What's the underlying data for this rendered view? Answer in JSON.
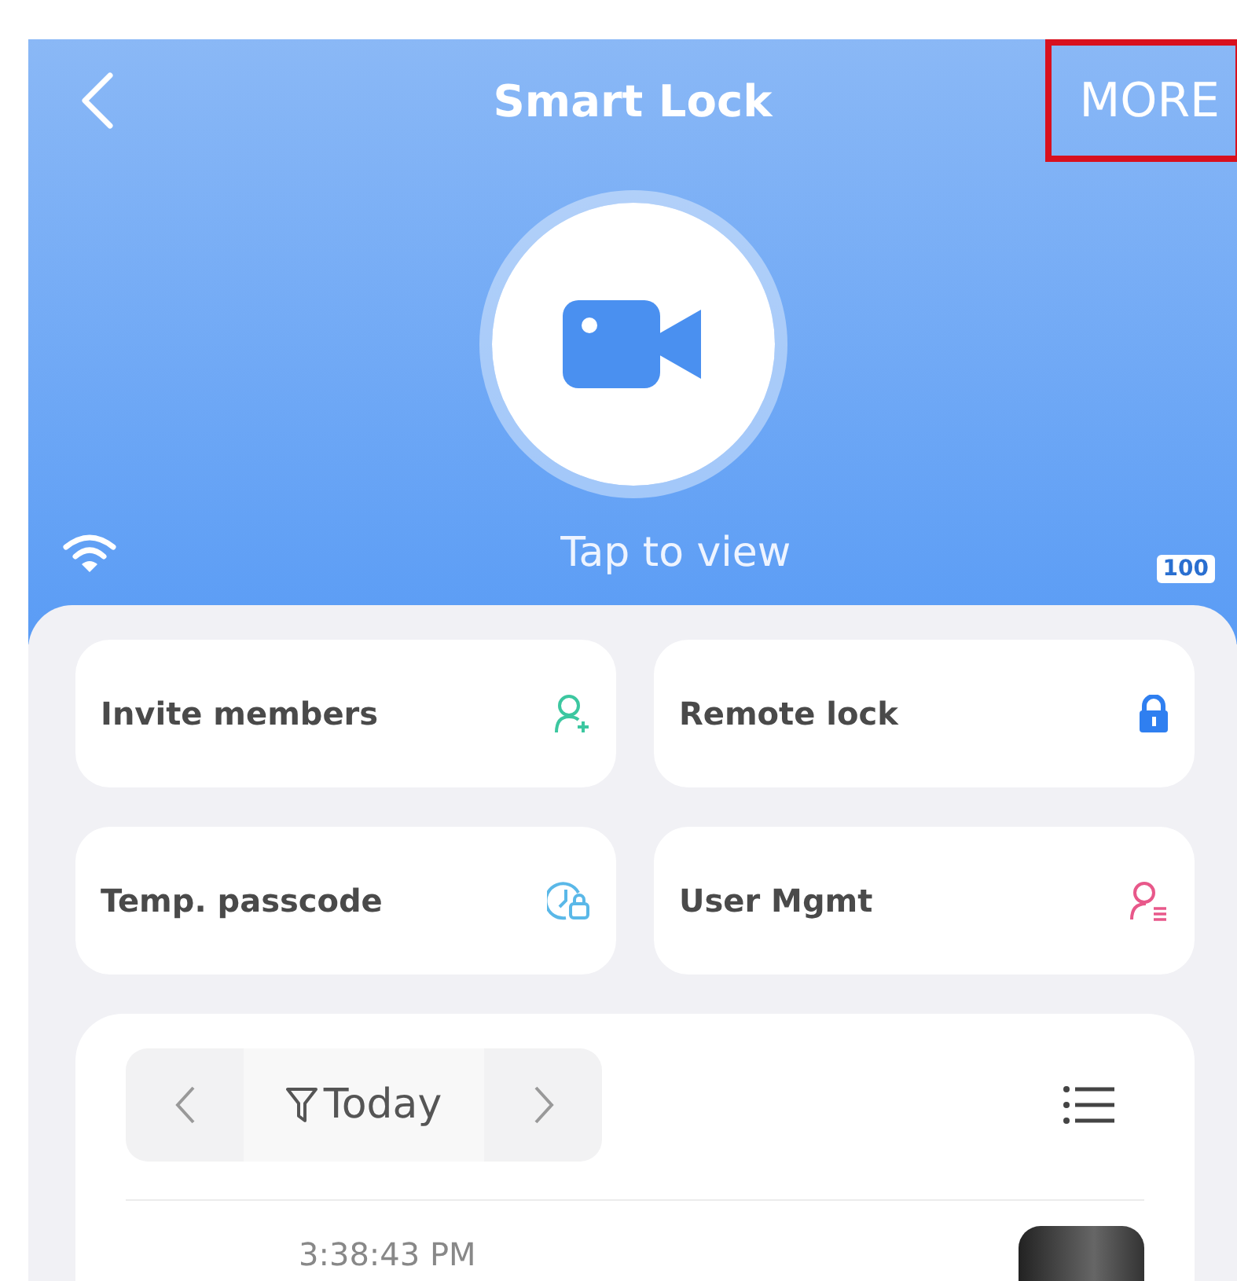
{
  "header": {
    "title": "Smart Lock",
    "more": {
      "label": "MORE",
      "highlighted": true
    },
    "camera_hint": "Tap to view",
    "battery": "100"
  },
  "actions": [
    {
      "label": "Invite members",
      "kind": "invite"
    },
    {
      "label": "Remote lock",
      "kind": "lock"
    },
    {
      "label": "Temp. passcode",
      "kind": "passcode"
    },
    {
      "label": "User Mgmt",
      "kind": "users"
    }
  ],
  "log": {
    "filter": "Today",
    "entries": [
      {
        "time": "3:38:43 PM"
      }
    ]
  }
}
